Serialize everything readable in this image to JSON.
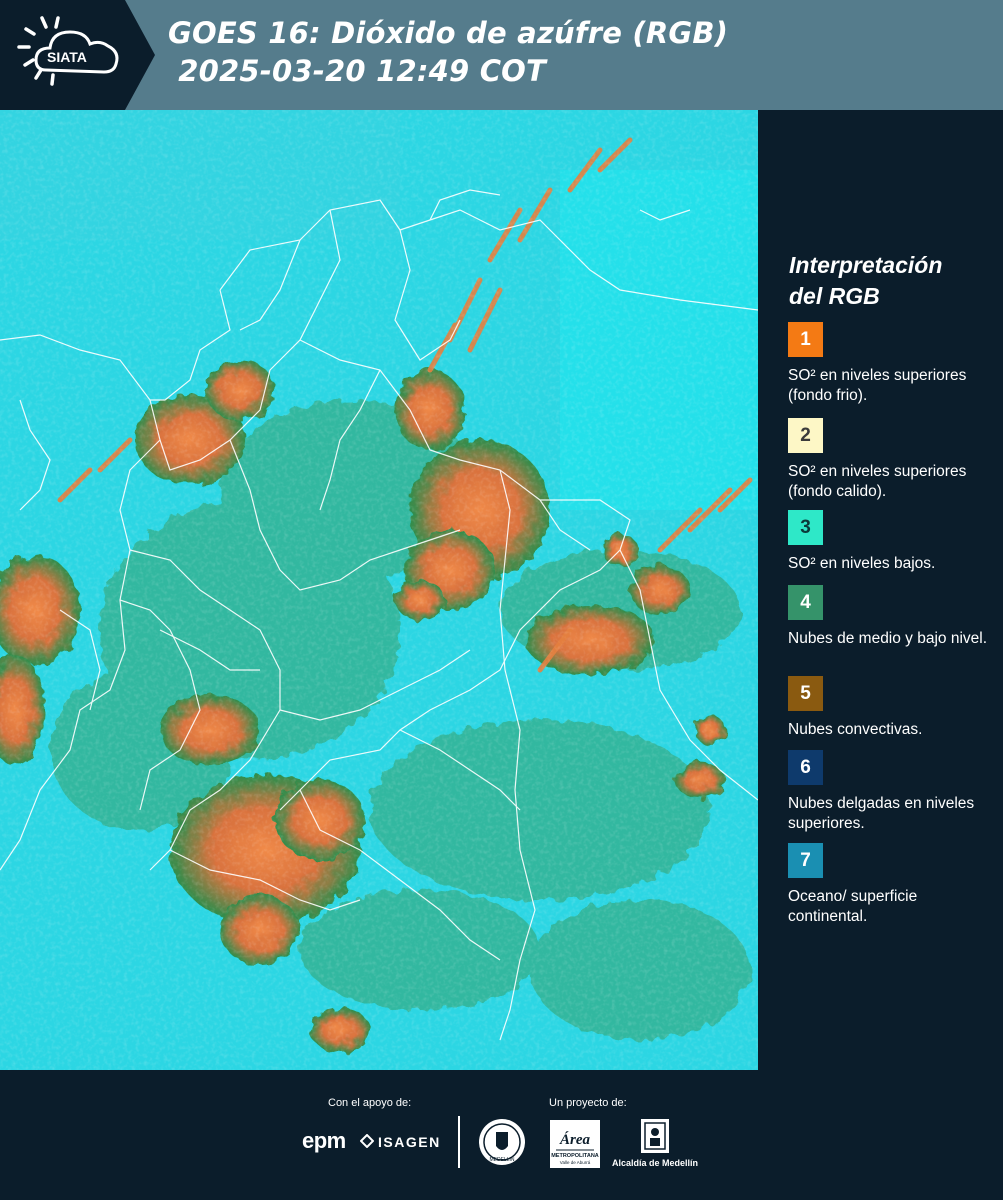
{
  "header": {
    "logo_text": "SIATA",
    "title_line1": "GOES 16: Dióxido de azúfre (RGB)",
    "title_line2": " 2025-03-20 12:49 COT"
  },
  "map": {
    "description_colors": {
      "ocean": "#2ad8e6",
      "surface": "#3fd6d8",
      "clouds_low": "#2e8f52",
      "clouds_convective": "#e07a3a",
      "borders": "#ffffff"
    }
  },
  "legend": {
    "title_line1": "Interpretación",
    "title_line2": "del RGB",
    "items": [
      {
        "number": "1",
        "color": "#f47a14",
        "text_color": "#ffffff",
        "description": "SO² en niveles superiores (fondo frio)."
      },
      {
        "number": "2",
        "color": "#fdf7c6",
        "text_color": "#3b3b3b",
        "description": "SO² en niveles superiores (fondo calido)."
      },
      {
        "number": "3",
        "color": "#2ee8c8",
        "text_color": "#0b3a3a",
        "description": "SO² en niveles bajos."
      },
      {
        "number": "4",
        "color": "#35936a",
        "text_color": "#ffffff",
        "description": "Nubes de medio y bajo nivel."
      },
      {
        "number": "5",
        "color": "#8a5a10",
        "text_color": "#ffffff",
        "description": "Nubes convectivas."
      },
      {
        "number": "6",
        "color": "#0e3a6c",
        "text_color": "#ffffff",
        "description": "Nubes delgadas en niveles superiores."
      },
      {
        "number": "7",
        "color": "#1a8fb2",
        "text_color": "#ffffff",
        "description": "Oceano/ superficie continental."
      }
    ]
  },
  "footer": {
    "support_label": "Con el apoyo de:",
    "project_label": "Un proyecto de:",
    "epm_text": "epm",
    "isagen_text": "ISAGEN",
    "area_text_main": "Área",
    "area_text_sub": "METROPOLITANA",
    "area_text_sub2": "Valle de Aburrá",
    "alcaldia_text": "Alcaldía de Medellín",
    "seal_text": "MEDELLIN"
  }
}
